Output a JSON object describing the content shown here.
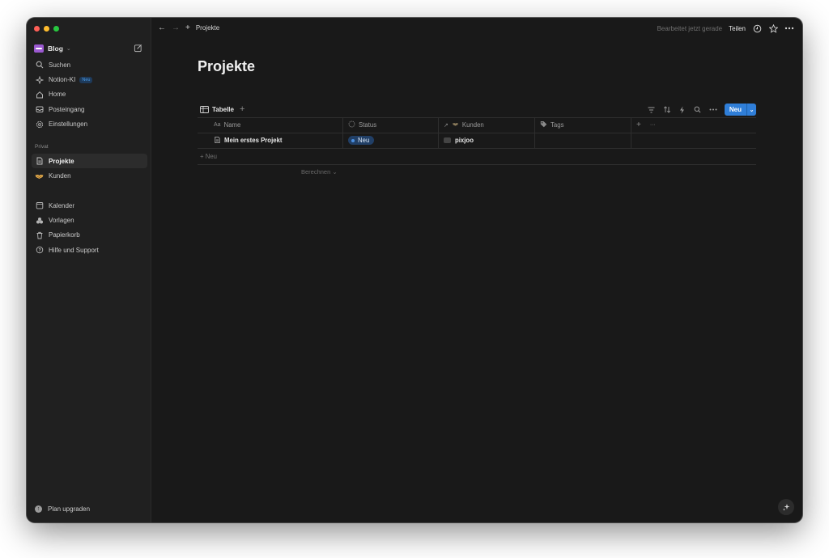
{
  "colors": {
    "accent": "#2f7ed8",
    "window_bg": "#191919",
    "sidebar_bg": "#202020",
    "traffic_red": "#fe5f57",
    "traffic_yellow": "#febc2e",
    "traffic_green": "#28c840",
    "status_pill_bg": "#213f66"
  },
  "sidebar": {
    "workspace": {
      "name": "Blog",
      "icon": "workspace-icon",
      "chevron": "⌄"
    },
    "items": [
      {
        "label": "Suchen",
        "icon": "search-icon"
      },
      {
        "label": "Notion-KI",
        "icon": "sparkle-icon",
        "badge": "Neu"
      },
      {
        "label": "Home",
        "icon": "home-icon"
      },
      {
        "label": "Posteingang",
        "icon": "inbox-icon"
      },
      {
        "label": "Einstellungen",
        "icon": "gear-icon"
      }
    ],
    "section_label": "Privat",
    "pages": [
      {
        "label": "Projekte",
        "icon": "page-icon",
        "active": true
      },
      {
        "label": "Kunden",
        "icon": "handshake-icon"
      }
    ],
    "tools": [
      {
        "label": "Kalender",
        "icon": "calendar-icon"
      },
      {
        "label": "Vorlagen",
        "icon": "templates-icon"
      },
      {
        "label": "Papierkorb",
        "icon": "trash-icon"
      },
      {
        "label": "Hilfe und Support",
        "icon": "help-icon"
      }
    ],
    "upgrade": "Plan upgraden"
  },
  "topbar": {
    "breadcrumb": "Projekte",
    "edited": "Bearbeitet jetzt gerade",
    "share": "Teilen"
  },
  "main": {
    "title": "Projekte",
    "view_tab": "Tabelle",
    "add_view": "+",
    "new_button": "Neu",
    "columns": {
      "name": "Name",
      "name_prefix": "Aa",
      "status": "Status",
      "kunden": "Kunden",
      "tags": "Tags",
      "add": "+",
      "more": "···"
    },
    "rows": [
      {
        "name": "Mein erstes Projekt",
        "status": "Neu",
        "kunden": "pixjoo",
        "tags": ""
      }
    ],
    "new_row": "+ Neu",
    "calculate": "Berechnen ⌄"
  }
}
